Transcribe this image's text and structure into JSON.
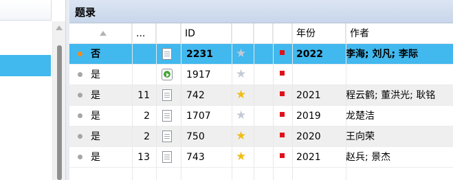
{
  "panel": {
    "title": "题录"
  },
  "columns": {
    "count": "...",
    "id": "ID",
    "year": "年份",
    "author": "作者"
  },
  "icons": {
    "sort": "sort-ascending-icon",
    "document": "document-icon",
    "video": "video-play-icon",
    "star": "star-icon",
    "flag": "red-flag-icon",
    "status_dot": "status-dot-icon"
  },
  "colors": {
    "selection": "#41b8ee",
    "title_bar": "#c8d6ea",
    "star_rated": "#f0bd18",
    "star_unrated": "#c3cad6",
    "flag": "#e0101b",
    "dot_active": "#f08c1e",
    "dot_default": "#a6a6a6"
  },
  "rows": [
    {
      "dot": "orange",
      "answered": "否",
      "count": "",
      "icon": "document",
      "id": "2231",
      "star": "gray",
      "flag": true,
      "year": "2022",
      "author": "李海; 刘凡; 李际",
      "selected": true
    },
    {
      "dot": "gray",
      "answered": "是",
      "count": "",
      "icon": "video",
      "id": "1917",
      "star": "gray",
      "flag": true,
      "year": "",
      "author": "",
      "selected": false
    },
    {
      "dot": "gray",
      "answered": "是",
      "count": "11",
      "icon": "document",
      "id": "742",
      "star": "gold",
      "flag": true,
      "year": "2021",
      "author": "程云鹤; 董洪光; 耿铭",
      "selected": false
    },
    {
      "dot": "gray",
      "answered": "是",
      "count": "2",
      "icon": "document",
      "id": "1707",
      "star": "gray",
      "flag": true,
      "year": "2019",
      "author": "龙楚洁",
      "selected": false
    },
    {
      "dot": "gray",
      "answered": "是",
      "count": "2",
      "icon": "document",
      "id": "750",
      "star": "gold",
      "flag": true,
      "year": "2020",
      "author": "王向荣",
      "selected": false
    },
    {
      "dot": "gray",
      "answered": "是",
      "count": "13",
      "icon": "document",
      "id": "743",
      "star": "gold",
      "flag": true,
      "year": "2021",
      "author": "赵兵; 景杰",
      "selected": false
    }
  ]
}
